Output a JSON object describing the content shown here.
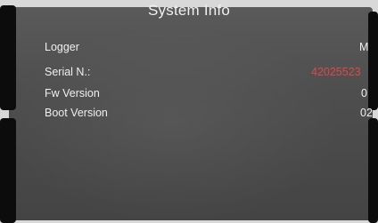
{
  "screen": {
    "title": "System Info",
    "rows": [
      {
        "label": "Logger",
        "value": "M"
      },
      {
        "label": "Serial N.:",
        "value": "42025523",
        "highlight": true
      },
      {
        "label": "Fw Version",
        "value": "0"
      },
      {
        "label": "Boot Version",
        "value": "02"
      }
    ]
  },
  "colors": {
    "text": "#efefef",
    "highlight_value": "#e04848",
    "background": "#4e4e4e",
    "bezel": "#0c0c0c"
  }
}
